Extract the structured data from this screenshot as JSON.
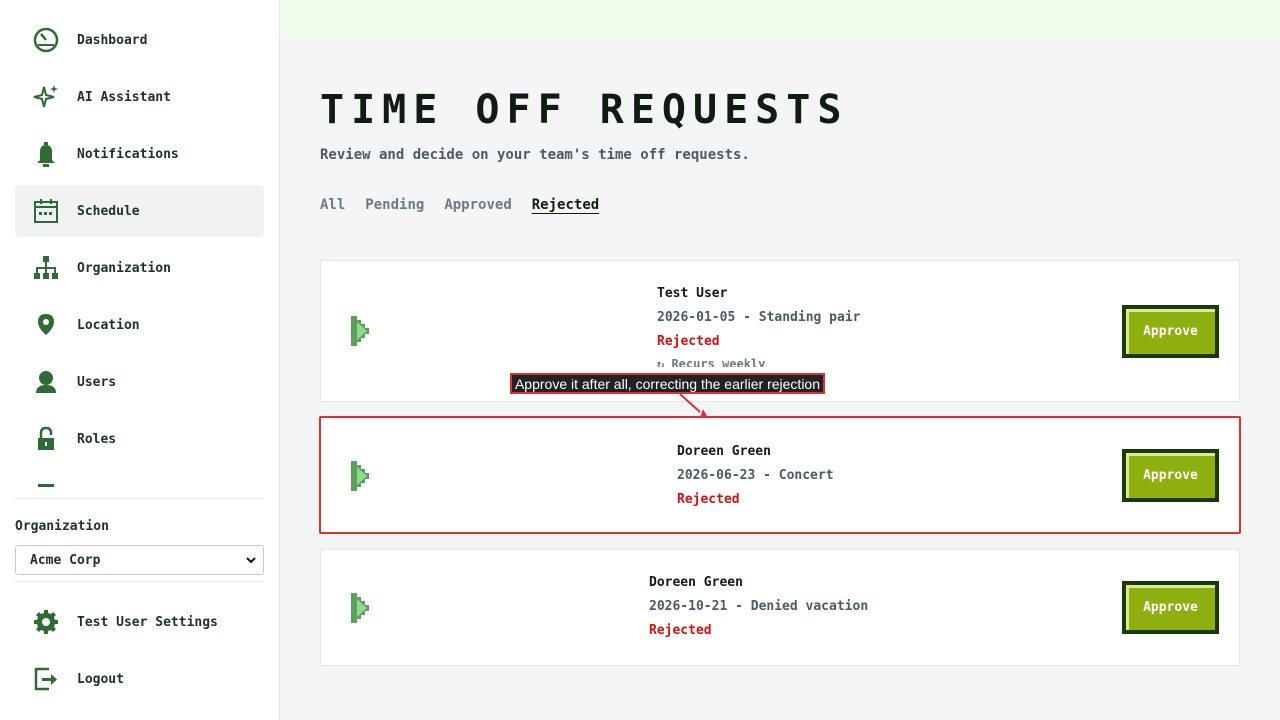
{
  "sidebar": {
    "items": [
      {
        "label": "Dashboard",
        "icon": "dashboard-icon"
      },
      {
        "label": "AI Assistant",
        "icon": "sparkle-icon"
      },
      {
        "label": "Notifications",
        "icon": "bell-icon"
      },
      {
        "label": "Schedule",
        "icon": "calendar-icon",
        "active": true
      },
      {
        "label": "Organization",
        "icon": "org-chart-icon"
      },
      {
        "label": "Location",
        "icon": "location-pin-icon"
      },
      {
        "label": "Users",
        "icon": "user-icon"
      },
      {
        "label": "Roles",
        "icon": "lock-icon"
      }
    ],
    "org_label": "Organization",
    "org_selected": "Acme Corp",
    "settings_label": "Test User Settings",
    "logout_label": "Logout"
  },
  "main": {
    "title": "TIME OFF REQUESTS",
    "subtitle": "Review and decide on your team's time off requests.",
    "tabs": [
      {
        "label": "All"
      },
      {
        "label": "Pending"
      },
      {
        "label": "Approved"
      },
      {
        "label": "Rejected",
        "active": true
      }
    ],
    "requests": [
      {
        "name": "Test User",
        "detail": "2026-01-05 - Standing pair",
        "status": "Rejected",
        "recurrence": "↻ Recurs weekly",
        "action": "Approve"
      },
      {
        "name": "Doreen Green",
        "detail": "2026-06-23 - Concert",
        "status": "Rejected",
        "action": "Approve"
      },
      {
        "name": "Doreen Green",
        "detail": "2026-10-21 - Denied vacation",
        "status": "Rejected",
        "action": "Approve"
      }
    ]
  },
  "annotation": {
    "text": "Approve it after all, correcting the earlier rejection"
  },
  "colors": {
    "accent_green": "#8fae10",
    "dark_green": "#1b3a0c",
    "status_red": "#d90f0f",
    "highlight_red": "#e32e2e"
  }
}
